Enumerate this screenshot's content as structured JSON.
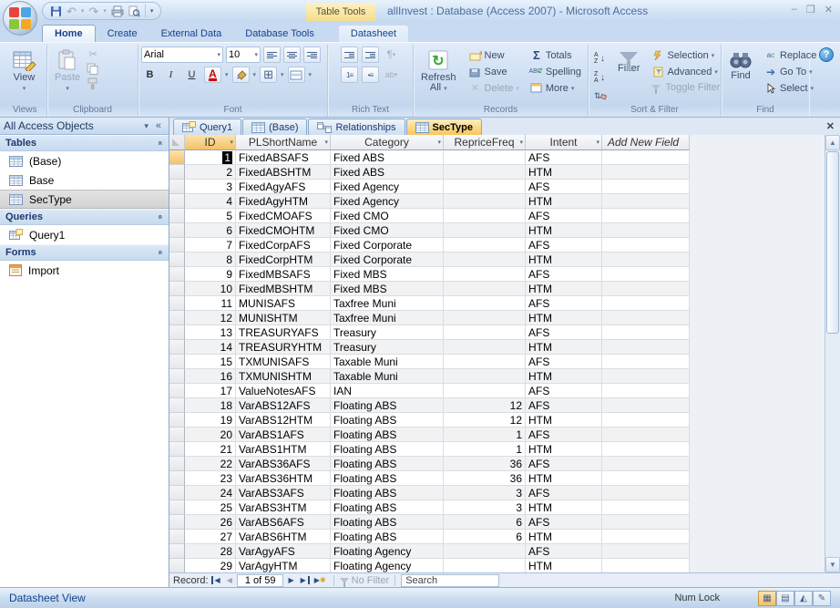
{
  "window": {
    "title": "allInvest : Database (Access 2007) - Microsoft Access",
    "tool_tab_group": "Table Tools",
    "minimize": "–",
    "restore": "❐",
    "close": "✕"
  },
  "ribbon_tabs": [
    {
      "label": "Home",
      "active": true
    },
    {
      "label": "Create"
    },
    {
      "label": "External Data"
    },
    {
      "label": "Database Tools"
    },
    {
      "label": "Datasheet",
      "contextual": true
    }
  ],
  "ribbon": {
    "views": {
      "group": "Views",
      "view": "View"
    },
    "clipboard": {
      "group": "Clipboard",
      "paste": "Paste"
    },
    "font": {
      "group": "Font",
      "family": "Arial",
      "size": "10"
    },
    "rich_text": {
      "group": "Rich Text"
    },
    "records": {
      "group": "Records",
      "refresh_line1": "Refresh",
      "refresh_line2": "All",
      "new": "New",
      "save": "Save",
      "delete": "Delete",
      "totals": "Totals",
      "spelling": "Spelling",
      "more": "More"
    },
    "sort_filter": {
      "group": "Sort & Filter",
      "filter": "Filter",
      "selection": "Selection",
      "advanced": "Advanced",
      "toggle_filter": "Toggle Filter"
    },
    "find": {
      "group": "Find",
      "find": "Find",
      "replace": "Replace",
      "go_to": "Go To",
      "select": "Select"
    },
    "help": "?"
  },
  "nav_pane": {
    "title": "All Access Objects",
    "sections": [
      {
        "label": "Tables",
        "items": [
          {
            "label": "(Base)",
            "icon": "table-icon"
          },
          {
            "label": "Base",
            "icon": "table-icon"
          },
          {
            "label": "SecType",
            "icon": "table-icon",
            "selected": true
          }
        ]
      },
      {
        "label": "Queries",
        "items": [
          {
            "label": "Query1",
            "icon": "query-icon"
          }
        ]
      },
      {
        "label": "Forms",
        "items": [
          {
            "label": "Import",
            "icon": "form-icon"
          }
        ]
      }
    ]
  },
  "document_tabs": [
    {
      "label": "Query1",
      "icon": "query-icon"
    },
    {
      "label": "(Base)",
      "icon": "table-icon"
    },
    {
      "label": "Relationships",
      "icon": "relationships-icon"
    },
    {
      "label": "SecType",
      "icon": "table-icon",
      "active": true
    }
  ],
  "datasheet": {
    "columns": [
      {
        "label": "ID",
        "sortable": true,
        "selected": true
      },
      {
        "label": "PLShortName",
        "sortable": true
      },
      {
        "label": "Category",
        "sortable": true
      },
      {
        "label": "RepriceFreq",
        "sortable": true
      },
      {
        "label": "Intent",
        "sortable": true
      },
      {
        "label": "Add New Field",
        "sortable": false
      }
    ],
    "rows": [
      [
        1,
        "FixedABSAFS",
        "Fixed ABS",
        "",
        "AFS"
      ],
      [
        2,
        "FixedABSHTM",
        "Fixed ABS",
        "",
        "HTM"
      ],
      [
        3,
        "FixedAgyAFS",
        "Fixed Agency",
        "",
        "AFS"
      ],
      [
        4,
        "FixedAgyHTM",
        "Fixed Agency",
        "",
        "HTM"
      ],
      [
        5,
        "FixedCMOAFS",
        "Fixed CMO",
        "",
        "AFS"
      ],
      [
        6,
        "FixedCMOHTM",
        "Fixed CMO",
        "",
        "HTM"
      ],
      [
        7,
        "FixedCorpAFS",
        "Fixed Corporate",
        "",
        "AFS"
      ],
      [
        8,
        "FixedCorpHTM",
        "Fixed Corporate",
        "",
        "HTM"
      ],
      [
        9,
        "FixedMBSAFS",
        "Fixed MBS",
        "",
        "AFS"
      ],
      [
        10,
        "FixedMBSHTM",
        "Fixed MBS",
        "",
        "HTM"
      ],
      [
        11,
        "MUNISAFS",
        "Taxfree Muni",
        "",
        "AFS"
      ],
      [
        12,
        "MUNISHTM",
        "Taxfree Muni",
        "",
        "HTM"
      ],
      [
        13,
        "TREASURYAFS",
        "Treasury",
        "",
        "AFS"
      ],
      [
        14,
        "TREASURYHTM",
        "Treasury",
        "",
        "HTM"
      ],
      [
        15,
        "TXMUNISAFS",
        "Taxable Muni",
        "",
        "AFS"
      ],
      [
        16,
        "TXMUNISHTM",
        "Taxable Muni",
        "",
        "HTM"
      ],
      [
        17,
        "ValueNotesAFS",
        "IAN",
        "",
        "AFS"
      ],
      [
        18,
        "VarABS12AFS",
        "Floating ABS",
        12,
        "AFS"
      ],
      [
        19,
        "VarABS12HTM",
        "Floating ABS",
        12,
        "HTM"
      ],
      [
        20,
        "VarABS1AFS",
        "Floating ABS",
        1,
        "AFS"
      ],
      [
        21,
        "VarABS1HTM",
        "Floating ABS",
        1,
        "HTM"
      ],
      [
        22,
        "VarABS36AFS",
        "Floating ABS",
        36,
        "AFS"
      ],
      [
        23,
        "VarABS36HTM",
        "Floating ABS",
        36,
        "HTM"
      ],
      [
        24,
        "VarABS3AFS",
        "Floating ABS",
        3,
        "AFS"
      ],
      [
        25,
        "VarABS3HTM",
        "Floating ABS",
        3,
        "HTM"
      ],
      [
        26,
        "VarABS6AFS",
        "Floating ABS",
        6,
        "AFS"
      ],
      [
        27,
        "VarABS6HTM",
        "Floating ABS",
        6,
        "HTM"
      ],
      [
        28,
        "VarAgyAFS",
        "Floating Agency",
        "",
        "AFS"
      ],
      [
        29,
        "VarAgyHTM",
        "Floating Agency",
        "",
        "HTM"
      ]
    ]
  },
  "record_nav": {
    "label": "Record:",
    "position": "1 of 59",
    "no_filter": "No Filter",
    "search": "Search"
  },
  "status_bar": {
    "view": "Datasheet View",
    "num_lock": "Num Lock"
  },
  "colors": {
    "active_tab_amber": "#f9c65c",
    "chrome_blue": "#c7daf1",
    "title_text": "#4a6e9e",
    "selection": "#000000"
  }
}
